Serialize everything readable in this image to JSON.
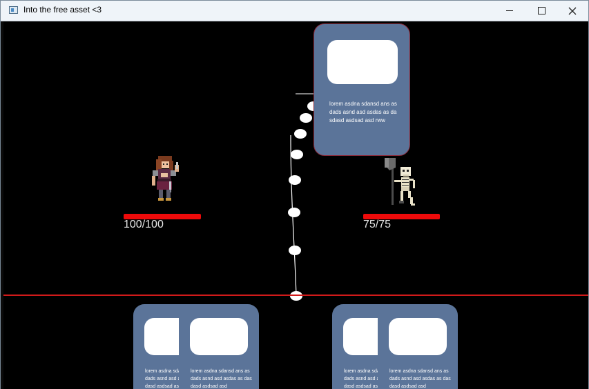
{
  "window": {
    "title": "Into the free asset <3"
  },
  "player": {
    "hp_text": "100/100",
    "hp_fraction": 1.0
  },
  "enemy": {
    "hp_text": "75/75",
    "hp_fraction": 1.0
  },
  "dragged_card": {
    "description": "lorem asdna sdansd ans as dads asnd asd asdas as dasdasd asdsad asd rww"
  },
  "hand": [
    {
      "description": "lorem asdna sdansd ans as dads asnd asd asdas as dasdasd asdsad asd"
    },
    {
      "description": "lorem asdna sdansd ans as dads asnd asd asdas as dasdasd asdsad asd"
    },
    {
      "description": "lorem asdna sdansd ans as dads asnd asd asdas as dasdasd asdsad asd"
    },
    {
      "description": "lorem asdna sdansd ans as dads asnd asd asdas as dasdasd asdsad asd"
    }
  ],
  "colors": {
    "card": "#5b7499",
    "health": "#ee0a0a",
    "ground_line": "#d11a1a",
    "background": "#000000"
  }
}
